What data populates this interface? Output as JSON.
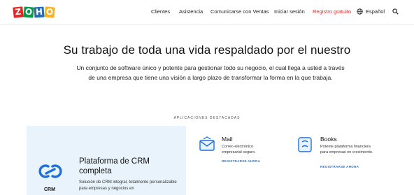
{
  "header": {
    "logo_letters": [
      "Z",
      "O",
      "H",
      "O"
    ],
    "logo_colors": [
      "#e42527",
      "#089949",
      "#226db4",
      "#f9b21d"
    ],
    "nav_links": [
      "Clientes",
      "Asistencia",
      "Comunicarse con Ventas",
      "Iniciar sesión",
      "Registro gratuito",
      "Español"
    ],
    "signup_color": "#e42527",
    "icons": [
      "globe-icon",
      "search-icon"
    ]
  },
  "hero": {
    "title": "Su trabajo de toda una vida respaldado por el nuestro",
    "description": "Un conjunto de software único y potente para gestionar todo su negocio, el cual llega a usted a través de una empresa que tiene una visión a largo plazo de transformar la forma en la que trabaja."
  },
  "featured": {
    "label": "APLICACIONES DESTACADAS",
    "crm": {
      "title": "Plataforma de CRM completa",
      "description": "Solución de CRM integral, totalmente personalizable para empresas y negocios en",
      "label": "CRM",
      "icon": "crm-icon"
    },
    "apps": [
      {
        "name": "Mail",
        "description": "Correo electrónico empresarial seguro.",
        "link": "REGISTRARSE AHORA",
        "icon": "mail-icon"
      },
      {
        "name": "Books",
        "description": "Potente plataforma financiera para empresas en crecimiento.",
        "link": "REGISTRARSE AHORA",
        "icon": "books-icon"
      }
    ],
    "accent_color": "#1e6fd9",
    "crm_panel_color": "#e8f3fb"
  }
}
